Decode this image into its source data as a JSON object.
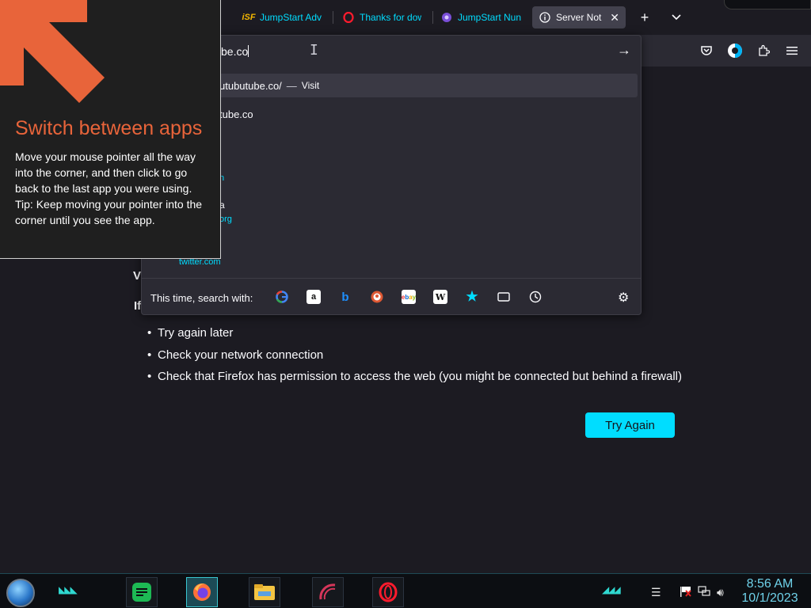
{
  "browser": {
    "tabs": [
      {
        "title": "JumpStart Adv",
        "favicon": "isf-icon"
      },
      {
        "title": "Thanks for dow",
        "favicon": "opera-icon"
      },
      {
        "title": "JumpStart Nun",
        "favicon": "jumpstart-icon"
      },
      {
        "title": "Server Not F",
        "favicon": "info-icon",
        "active": true
      }
    ],
    "new_tab": "+",
    "list_tabs": "⌄"
  },
  "urlbar": {
    "value": "be.co",
    "visit_row": {
      "url": "utubutube.co/",
      "separator": "—",
      "action": "Visit"
    },
    "history_row": "tube.co",
    "fragments": [
      {
        "text": "n",
        "kind": "link"
      },
      {
        "text": "a",
        "kind": "text"
      },
      {
        "text": "org",
        "kind": "link"
      },
      {
        "text": "twitter.com",
        "kind": "link"
      }
    ],
    "search_with_label": "This time, search with:",
    "engines": [
      "google-icon",
      "amazon-icon",
      "bing-icon",
      "duckduckgo-icon",
      "ebay-icon",
      "wikipedia-icon",
      "bookmarks-icon",
      "tabs-icon",
      "history-icon"
    ]
  },
  "page": {
    "heading_fragment": "V",
    "subheading_fragment": "If",
    "suggestions": [
      "Try again later",
      "Check your network connection",
      "Check that Firefox has permission to access the web (you might be connected but behind a firewall)"
    ],
    "try_again_label": "Try Again"
  },
  "tip": {
    "title": "Switch between apps",
    "body": "Move your mouse pointer all the way into the corner, and then click to go back to the last app you were using.",
    "tip": "Tip: Keep moving your pointer into the corner until you see the app."
  },
  "taskbar": {
    "apps": [
      "notes-app-icon",
      "firefox-icon",
      "file-explorer-icon",
      "arc-app-icon",
      "opera-icon"
    ],
    "time": "8:56 AM",
    "date": "10/1/2023"
  },
  "colors": {
    "accent": "#00ddff",
    "tip_title": "#e8643a",
    "clock": "#6fd2ea"
  }
}
